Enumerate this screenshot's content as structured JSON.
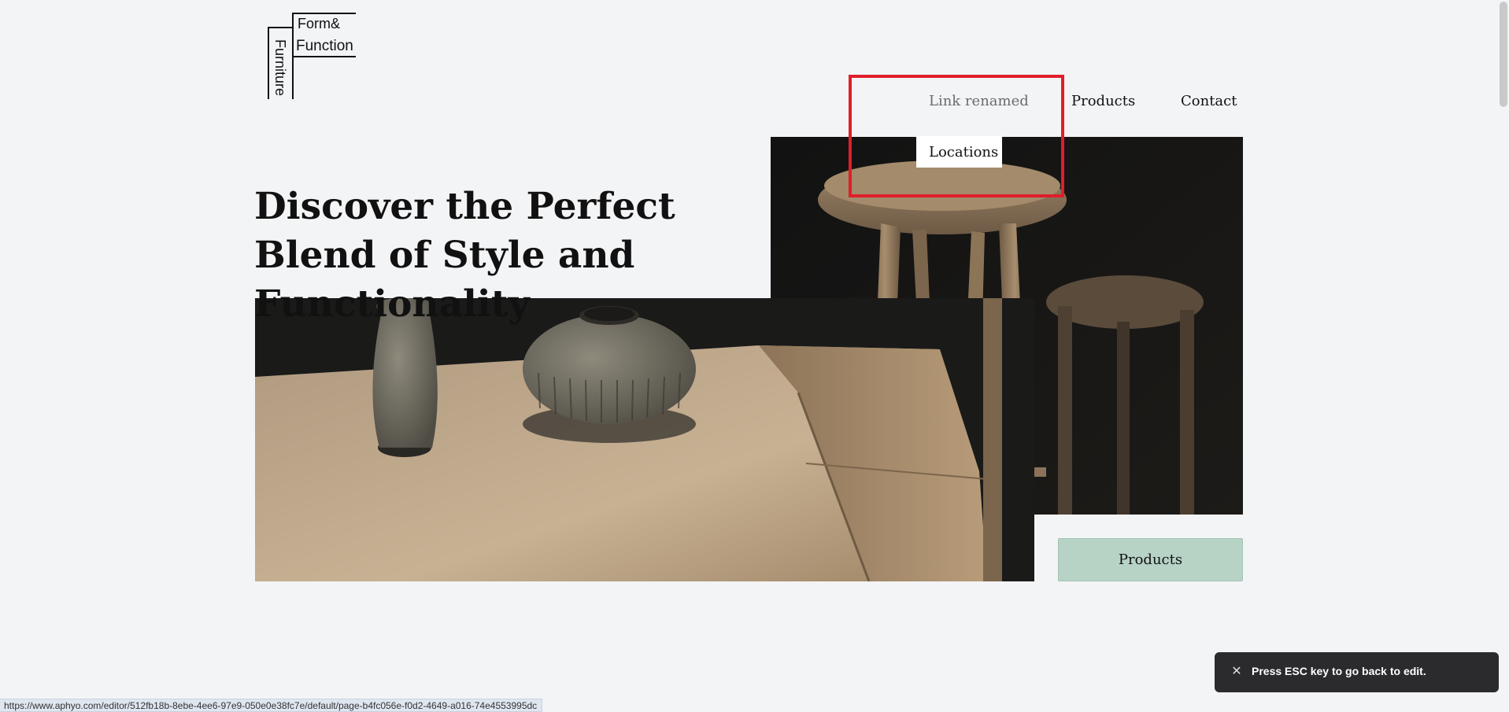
{
  "logo": {
    "form": "Form&",
    "function": "Function",
    "furniture": "Furniture"
  },
  "nav": {
    "renamed_label": "Link renamed",
    "products_label": "Products",
    "contact_label": "Contact",
    "dropdown_item": "Locations"
  },
  "hero": {
    "title": "Discover the Perfect Blend of Style and Functionality",
    "cta_label": "Products"
  },
  "status_url": "https://www.aphyo.com/editor/512fb18b-8ebe-4ee6-97e9-050e0e38fc7e/default/page-b4fc056e-f0d2-4649-a016-74e4553995dc",
  "toast": {
    "message": "Press ESC key to go back to edit."
  },
  "colors": {
    "background": "#f3f4f6",
    "highlight": "#e01e2a",
    "cta_bg": "#b6d3c6",
    "toast_bg": "#2b2b2e"
  }
}
